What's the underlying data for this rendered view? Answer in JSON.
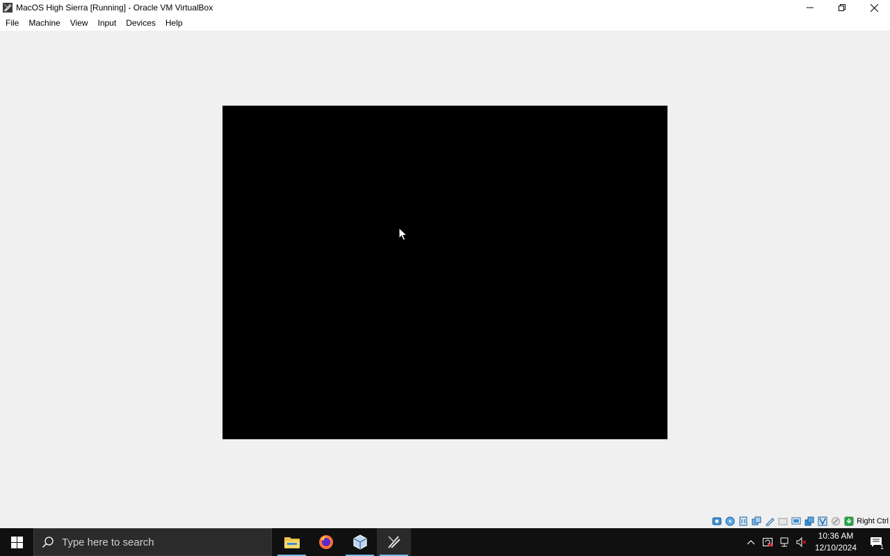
{
  "window": {
    "title": "MacOS High Sierra [Running] - Oracle VM VirtualBox",
    "icon": "virtualbox-vm-icon"
  },
  "menu": {
    "items": [
      {
        "label": "File"
      },
      {
        "label": "Machine"
      },
      {
        "label": "View"
      },
      {
        "label": "Input"
      },
      {
        "label": "Devices"
      },
      {
        "label": "Help"
      }
    ]
  },
  "statusbar": {
    "icons": [
      "hard-disk-icon",
      "optical-drive-icon",
      "audio-icon",
      "network-icon",
      "usb-icon",
      "shared-folders-icon",
      "display-icon",
      "video-capture-icon",
      "virtualization-icon",
      "mouse-integration-icon",
      "keyboard-capture-icon"
    ],
    "host_key": "Right Ctrl"
  },
  "taskbar": {
    "search_placeholder": "Type here to search",
    "apps": [
      "file-explorer-icon",
      "firefox-icon",
      "virtualbox-manager-icon",
      "virtualbox-vm-icon"
    ],
    "time": "10:36 AM",
    "date": "12/10/2024",
    "notification_count": "1"
  }
}
